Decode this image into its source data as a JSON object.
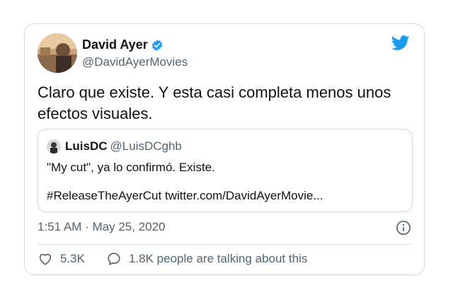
{
  "author": {
    "name": "David Ayer",
    "handle": "@DavidAyerMovies"
  },
  "tweet": {
    "text": "Claro que existe. Y esta casi completa menos unos efectos visuales.",
    "timestamp": "1:51 AM · May 25, 2020",
    "likes": "5.3K",
    "talking": "1.8K people are talking about this"
  },
  "quoted": {
    "name": "LuisDC",
    "handle": "@LuisDCghb",
    "line1": "\"My cut\", ya lo confirmó. Existe.",
    "line2": "#ReleaseTheAyerCut twitter.com/DavidAyerMovie..."
  },
  "colors": {
    "twitter_blue": "#1d9bf0",
    "text_secondary": "#536471",
    "border": "#cfd9de"
  },
  "icons": {
    "brand": "twitter-bird-icon",
    "verified": "verified-badge-icon",
    "info": "info-icon",
    "like": "heart-icon",
    "reply": "speech-bubble-icon"
  }
}
